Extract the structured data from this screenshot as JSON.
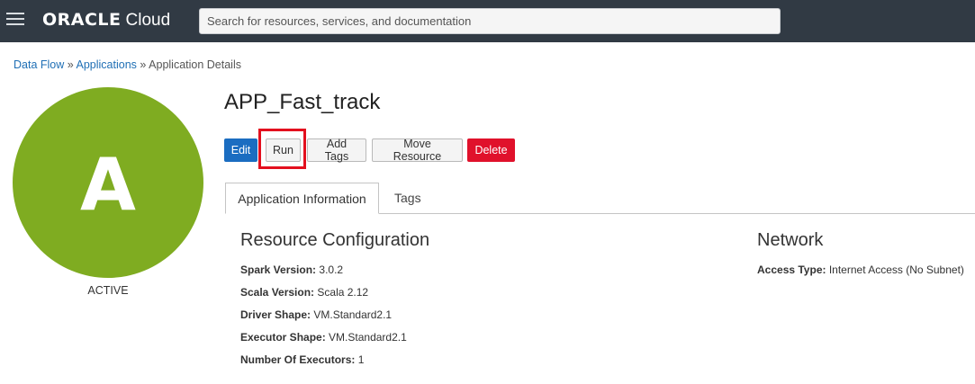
{
  "header": {
    "brand": "ORACLE",
    "product": "Cloud",
    "search_placeholder": "Search for resources, services, and documentation"
  },
  "breadcrumb": {
    "items": [
      "Data Flow",
      "Applications",
      "Application Details"
    ],
    "separator": "»"
  },
  "avatar": {
    "letter": "A",
    "color": "#7fac21"
  },
  "status": "ACTIVE",
  "title": "APP_Fast_track",
  "actions": {
    "edit": "Edit",
    "run": "Run",
    "add_tags": "Add Tags",
    "move_resource": "Move Resource",
    "delete": "Delete"
  },
  "tabs": [
    "Application Information",
    "Tags"
  ],
  "resource_configuration": {
    "title": "Resource Configuration",
    "fields": [
      {
        "label": "Spark Version:",
        "value": "3.0.2"
      },
      {
        "label": "Scala Version:",
        "value": "Scala 2.12"
      },
      {
        "label": "Driver Shape:",
        "value": "VM.Standard2.1"
      },
      {
        "label": "Executor Shape:",
        "value": "VM.Standard2.1"
      },
      {
        "label": "Number Of Executors:",
        "value": "1"
      }
    ]
  },
  "network": {
    "title": "Network",
    "fields": [
      {
        "label": "Access Type:",
        "value": "Internet Access (No Subnet)"
      }
    ]
  }
}
